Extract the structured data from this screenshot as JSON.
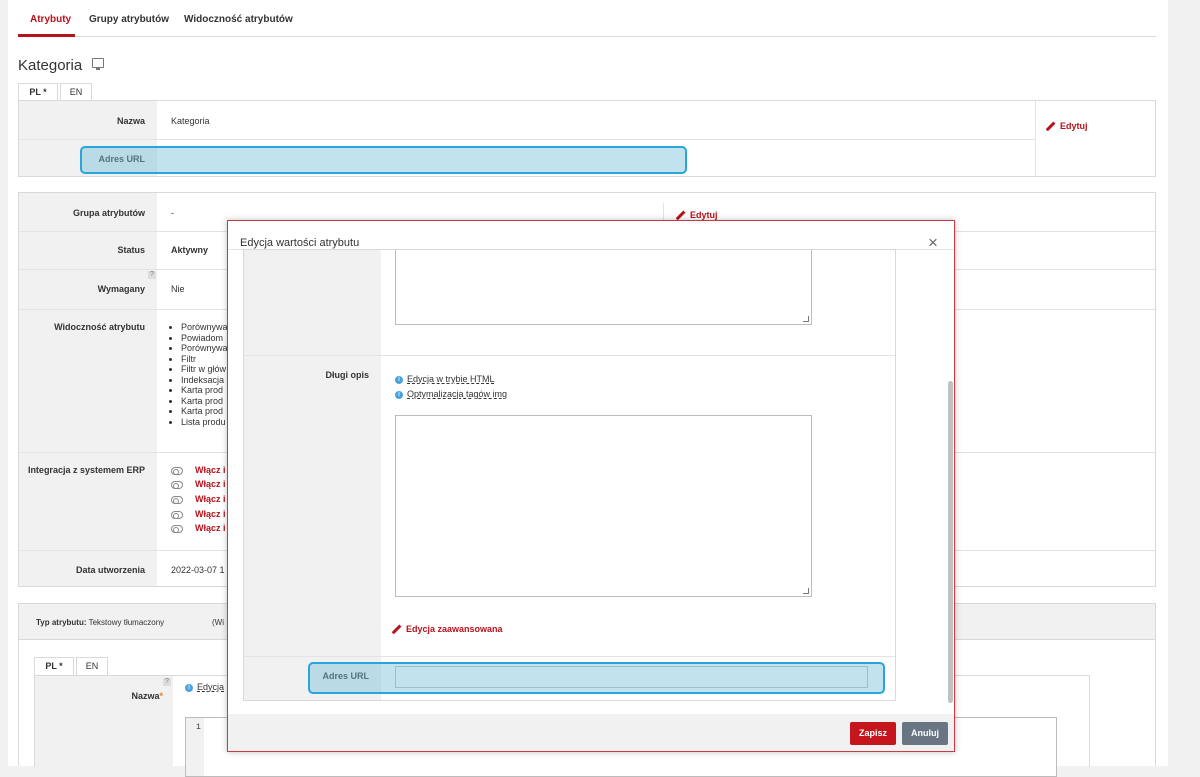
{
  "tabs": [
    {
      "label": "Atrybuty"
    },
    {
      "label": "Grupy atrybutów"
    },
    {
      "label": "Widoczność atrybutów"
    }
  ],
  "page_title": "Kategoria",
  "lang_tabs": [
    "PL *",
    "EN"
  ],
  "name_section": {
    "name_label": "Nazwa",
    "name_value": "Kategoria",
    "url_label": "Adres URL",
    "edit_label": "Edytuj"
  },
  "details": {
    "group_label": "Grupa atrybutów",
    "group_value": "-",
    "edit_label": "Edytuj",
    "status_label": "Status",
    "status_value": "Aktywny",
    "required_label": "Wymagany",
    "required_value": "Nie",
    "help_badge": "?",
    "visibility_label": "Widoczność atrybutu",
    "visibility_items": [
      "Porównywa",
      "Powiadom",
      "Porównywa",
      "Filtr",
      "Filtr w głów",
      "Indeksacja",
      "Karta prod",
      "Karta prod",
      "Karta prod",
      "Lista produ"
    ],
    "erp_label": "Integracja z systemem ERP",
    "erp_toggles": [
      "Włącz i",
      "Włącz i",
      "Włącz i",
      "Włącz i",
      "Włącz i"
    ],
    "created_label": "Data utworzenia",
    "created_value": "2022-03-07 1"
  },
  "type_bar": {
    "type_label": "Typ atrybutu:",
    "type_value": "Tekstowy tłumaczony",
    "extra": "(Wi"
  },
  "bottom": {
    "lang_tabs": [
      "PL *",
      "EN"
    ],
    "name_label": "Nazwa",
    "required_mark": "*",
    "edit_link": "Edycja",
    "line_number": "1"
  },
  "modal": {
    "title": "Edycja wartości atrybutu",
    "close": "×",
    "long_desc_label": "Długi opis",
    "html_link": "Edycja w trybie HTML",
    "img_link": "Optymalizacja tagów img",
    "advanced_edit": "Edycja zaawansowana",
    "url_label": "Adres URL",
    "url_value": "",
    "save": "Zapisz",
    "cancel": "Anuluj"
  }
}
